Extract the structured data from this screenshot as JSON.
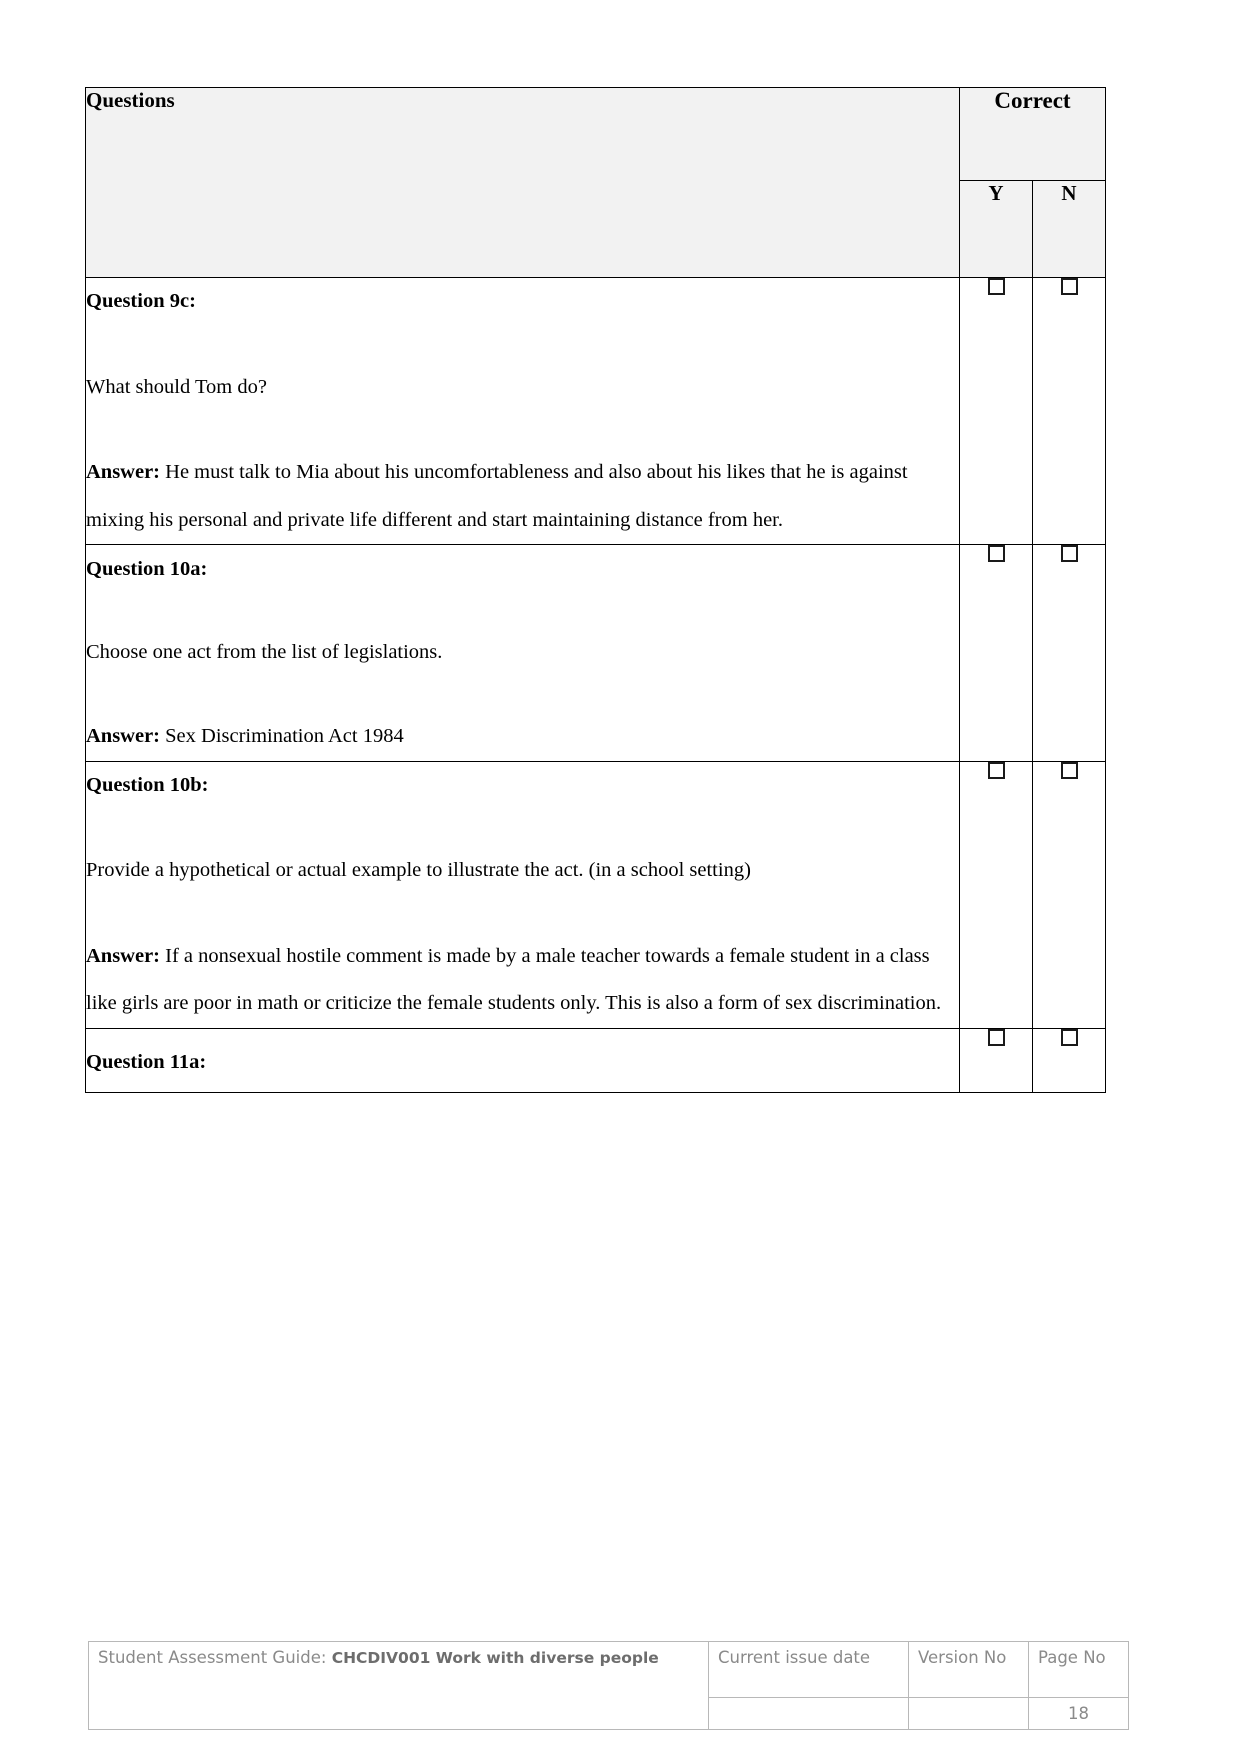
{
  "table": {
    "header": {
      "questions_label": "Questions",
      "correct_label": "Correct",
      "yes_label": "Y",
      "no_label": "N"
    },
    "rows": [
      {
        "id": "question-9c",
        "label": "Question 9c:",
        "prompt": "What should Tom do?",
        "answer_lead": "Answer:",
        "answer_text": " He must talk to Mia about his uncomfortableness and also about his likes that he is against mixing his personal and private life different and start maintaining distance from her."
      },
      {
        "id": "question-10a",
        "label": "Question 10a:",
        "prompt": "Choose one act from the list of legislations.",
        "answer_lead": "Answer:",
        "answer_text": " Sex Discrimination Act 1984"
      },
      {
        "id": "question-10b",
        "label": "Question 10b:",
        "prompt": "Provide a hypothetical or actual example to illustrate the act. (in a school setting)",
        "answer_lead": "Answer:",
        "answer_text": " If a nonsexual hostile comment is made by a male teacher towards a female student in a class like girls are poor in math or criticize the female students only. This is also a form of sex discrimination."
      },
      {
        "id": "question-11a",
        "label": "Question 11a:",
        "prompt": "",
        "answer_lead": "",
        "answer_text": ""
      }
    ]
  },
  "footer": {
    "guide_prefix": "Student Assessment Guide:",
    "guide_unit": "CHCDIV001 Work with diverse people",
    "current_issue_date_label": "Current issue date",
    "version_no_label": "Version No",
    "page_no_label": "Page No",
    "current_issue_date_value": "",
    "version_no_value": "",
    "page_no_value": "18"
  },
  "colors": {
    "header_fill": "#f2f2f2",
    "border": "#000000",
    "footer_border": "#b8b8b8",
    "footer_text": "#8a8a8a"
  }
}
